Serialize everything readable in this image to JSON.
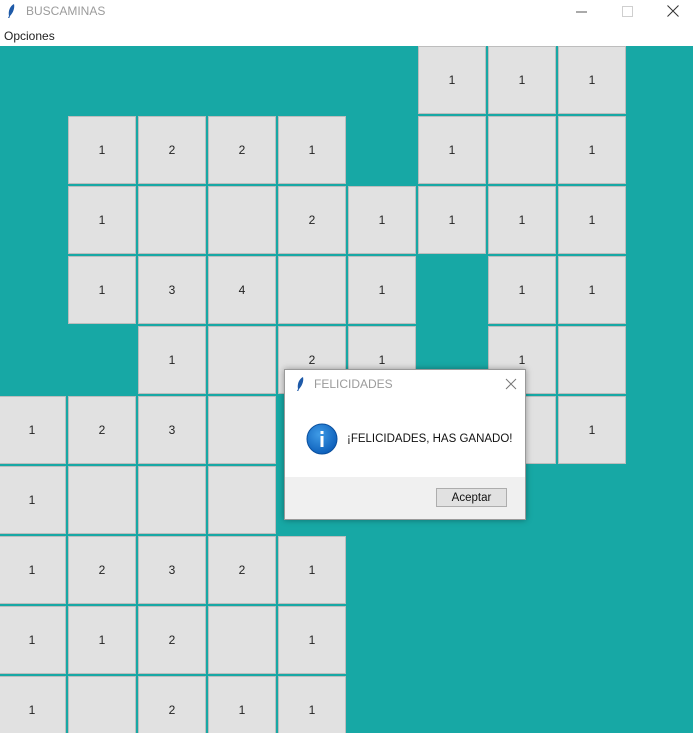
{
  "window": {
    "title": "BUSCAMINAS",
    "controls": [
      "minimize",
      "maximize",
      "close"
    ]
  },
  "menu": {
    "items": [
      "Opciones"
    ]
  },
  "board": {
    "background": "#17a8a5",
    "cell_color": "#e1e1e1",
    "cells": [
      {
        "row": 0,
        "col": 7,
        "v": "1"
      },
      {
        "row": 0,
        "col": 8,
        "v": "1"
      },
      {
        "row": 0,
        "col": 9,
        "v": "1"
      },
      {
        "row": 1,
        "col": 2,
        "v": "1"
      },
      {
        "row": 1,
        "col": 3,
        "v": "2"
      },
      {
        "row": 1,
        "col": 4,
        "v": "2"
      },
      {
        "row": 1,
        "col": 5,
        "v": "1"
      },
      {
        "row": 1,
        "col": 7,
        "v": "1"
      },
      {
        "row": 1,
        "col": 8,
        "v": ""
      },
      {
        "row": 1,
        "col": 9,
        "v": "1"
      },
      {
        "row": 2,
        "col": 2,
        "v": "1"
      },
      {
        "row": 2,
        "col": 3,
        "v": ""
      },
      {
        "row": 2,
        "col": 4,
        "v": ""
      },
      {
        "row": 2,
        "col": 5,
        "v": "2"
      },
      {
        "row": 2,
        "col": 6,
        "v": "1"
      },
      {
        "row": 2,
        "col": 7,
        "v": "1"
      },
      {
        "row": 2,
        "col": 8,
        "v": "1"
      },
      {
        "row": 2,
        "col": 9,
        "v": "1"
      },
      {
        "row": 3,
        "col": 2,
        "v": "1"
      },
      {
        "row": 3,
        "col": 3,
        "v": "3"
      },
      {
        "row": 3,
        "col": 4,
        "v": "4"
      },
      {
        "row": 3,
        "col": 5,
        "v": ""
      },
      {
        "row": 3,
        "col": 6,
        "v": "1"
      },
      {
        "row": 3,
        "col": 8,
        "v": "1"
      },
      {
        "row": 3,
        "col": 9,
        "v": "1"
      },
      {
        "row": 4,
        "col": 3,
        "v": "1"
      },
      {
        "row": 4,
        "col": 4,
        "v": ""
      },
      {
        "row": 4,
        "col": 5,
        "v": "2"
      },
      {
        "row": 4,
        "col": 6,
        "v": "1"
      },
      {
        "row": 4,
        "col": 8,
        "v": "1"
      },
      {
        "row": 4,
        "col": 9,
        "v": ""
      },
      {
        "row": 5,
        "col": 1,
        "v": "1"
      },
      {
        "row": 5,
        "col": 2,
        "v": "2"
      },
      {
        "row": 5,
        "col": 3,
        "v": "3"
      },
      {
        "row": 5,
        "col": 4,
        "v": ""
      },
      {
        "row": 5,
        "col": 8,
        "v": "1"
      },
      {
        "row": 5,
        "col": 9,
        "v": "1"
      },
      {
        "row": 6,
        "col": 1,
        "v": "1"
      },
      {
        "row": 6,
        "col": 2,
        "v": ""
      },
      {
        "row": 6,
        "col": 3,
        "v": ""
      },
      {
        "row": 6,
        "col": 4,
        "v": ""
      },
      {
        "row": 7,
        "col": 1,
        "v": "1"
      },
      {
        "row": 7,
        "col": 2,
        "v": "2"
      },
      {
        "row": 7,
        "col": 3,
        "v": "3"
      },
      {
        "row": 7,
        "col": 4,
        "v": "2"
      },
      {
        "row": 7,
        "col": 5,
        "v": "1"
      },
      {
        "row": 8,
        "col": 1,
        "v": "1"
      },
      {
        "row": 8,
        "col": 2,
        "v": "1"
      },
      {
        "row": 8,
        "col": 3,
        "v": "2"
      },
      {
        "row": 8,
        "col": 4,
        "v": ""
      },
      {
        "row": 8,
        "col": 5,
        "v": "1"
      },
      {
        "row": 9,
        "col": 1,
        "v": "1"
      },
      {
        "row": 9,
        "col": 2,
        "v": ""
      },
      {
        "row": 9,
        "col": 3,
        "v": "2"
      },
      {
        "row": 9,
        "col": 4,
        "v": "1"
      },
      {
        "row": 9,
        "col": 5,
        "v": "1"
      }
    ]
  },
  "dialog": {
    "title": "FELICIDADES",
    "icon": "info-icon",
    "message": "¡FELICIDADES, HAS GANADO!",
    "button_label": "Aceptar"
  }
}
